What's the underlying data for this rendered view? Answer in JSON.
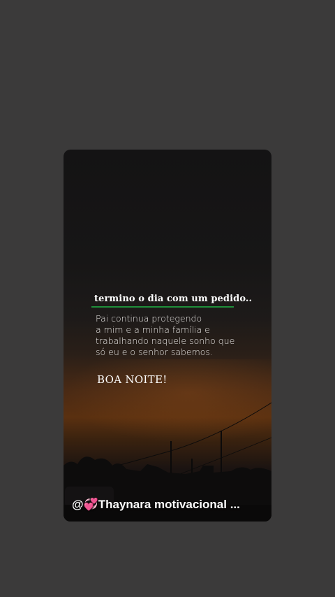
{
  "story": {
    "title": "termino o dia com um pedido..",
    "body_lines": [
      "Pai continua protegendo",
      "a mim e a minha família e",
      "trabalhando naquele sonho que",
      "só eu e o senhor sabemos."
    ],
    "closing": "BOA NOITE!",
    "attribution_prefix": "@",
    "attribution_emoji": "💞",
    "attribution_name": "Thaynara motivacional ..."
  },
  "colors": {
    "background": "#3b3a3a",
    "title_underline": "#1f8f3a",
    "text": "#ffffff"
  }
}
